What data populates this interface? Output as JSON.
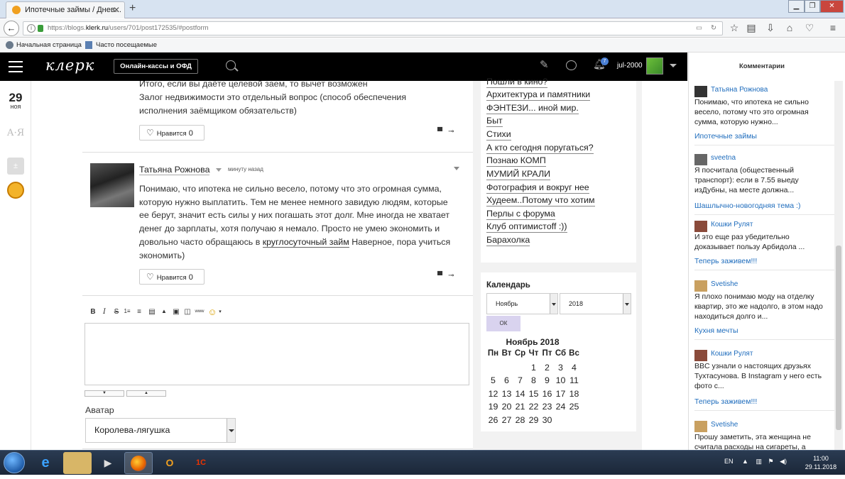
{
  "browser": {
    "tab_title": "Ипотечные займы / Днев...",
    "url_prefix": "https://blogs.",
    "url_host": "klerk.ru",
    "url_path": "/users/701/post172535/#postform",
    "bookmarks": [
      "Начальная страница",
      "Часто посещаемые"
    ]
  },
  "header": {
    "logo": "клерк",
    "kassy_button": "Онлайн-кассы и ОФД",
    "notifications_count": "7",
    "username": "jul-2000"
  },
  "left_rail": {
    "day": "29",
    "month": "ноя",
    "aya_label": "А·Я"
  },
  "comments": [
    {
      "lines": [
        "Итого, если вы даёте целевой заем, то вычет возможен",
        "Залог недвижимости это отдельный вопрос (способ обеспечения",
        "исполнения заёмщиком обязательств)"
      ],
      "like_label": "Нравится",
      "like_count": "0"
    },
    {
      "author": "Татьяна Рожнова",
      "time": "минуту назад",
      "text_before_link": "Понимаю, что ипотека не сильно весело, потому что это огромная сумма, которую нужно выплатить. Тем не менее немного завидую людям, которые ее берут, значит есть силы у них погашать этот долг. Мне иногда не хватает денег до зарплаты, хотя получаю я немало. Просто не умею экономить и довольно часто обращаюсь в ",
      "link_text": "круглосуточный займ",
      "text_after_link": " Наверное, пора учиться экономить)",
      "like_label": "Нравится",
      "like_count": "0"
    }
  ],
  "editor": {
    "toolbar": [
      "B",
      "I",
      "S",
      "1≡",
      "≡",
      "▤",
      "▲",
      "▣",
      "◫",
      "www",
      "☺"
    ],
    "avatar_label": "Аватар",
    "avatar_value": "Королева-лягушка"
  },
  "categories": [
    "Пошли в кино?",
    "Архитектура и памятники",
    "ФЭНТЕЗИ... иной мир.",
    "Быт",
    "Стихи",
    "А кто сегодня поругаться?",
    "Познаю КОМП",
    "МУМИЙ КРАЛИ",
    "Фотография и вокруг нее",
    "Худеем..Потому что хотим",
    "Перлы с форума",
    "Клуб оптимистoff :))",
    "Барахолка"
  ],
  "calendar": {
    "title": "Календарь",
    "month_select": "Ноябрь",
    "year_select": "2018",
    "ok_button": "ОК",
    "heading": "Ноябрь 2018",
    "weekdays": [
      "Пн",
      "Вт",
      "Ср",
      "Чт",
      "Пт",
      "Сб",
      "Вс"
    ],
    "weeks": [
      [
        "",
        "",
        "",
        "1",
        "2",
        "3",
        "4"
      ],
      [
        "5",
        "6",
        "7",
        "8",
        "9",
        "10",
        "11"
      ],
      [
        "12",
        "13",
        "14",
        "15",
        "16",
        "17",
        "18"
      ],
      [
        "19",
        "20",
        "21",
        "22",
        "23",
        "24",
        "25"
      ],
      [
        "26",
        "27",
        "28",
        "29",
        "30",
        "",
        ""
      ]
    ]
  },
  "right_panel": {
    "title": "Комментарии",
    "items": [
      {
        "user": "Татьяна Рожнова",
        "text": "Понимаю, что ипотека не сильно весело, потому что это огромная сумма, которую нужно...",
        "link": "Ипотечные займы"
      },
      {
        "user": "sveetna",
        "text": "Я посчитала (общественный транспорт): если в 7.55 выеду изДубны, на месте должна...",
        "link": "Шашлычно-новогодняя тема :)"
      },
      {
        "user": "Кошки Рулят",
        "text": "И это еще раз убедительно доказывает пользу Арбидола ...",
        "link": "Теперь заживем!!!"
      },
      {
        "user": "Svetishe",
        "text": "Я плохо понимаю моду на отделку квартир, это же надолго, в этом надо находиться долго и...",
        "link": "Кухня мечты"
      },
      {
        "user": "Кошки Рулят",
        "text": "BBC узнали о настоящих друзьях Тухтасунова. В Instagram у него есть фото с...",
        "link": "Теперь заживем!!!"
      },
      {
        "user": "Svetishe",
        "text": "Прошу заметить, эта женщина не считала расходы на сигареты, а",
        "link": ""
      }
    ]
  },
  "taskbar": {
    "lang": "EN",
    "time": "11:00",
    "date": "29.11.2018"
  }
}
